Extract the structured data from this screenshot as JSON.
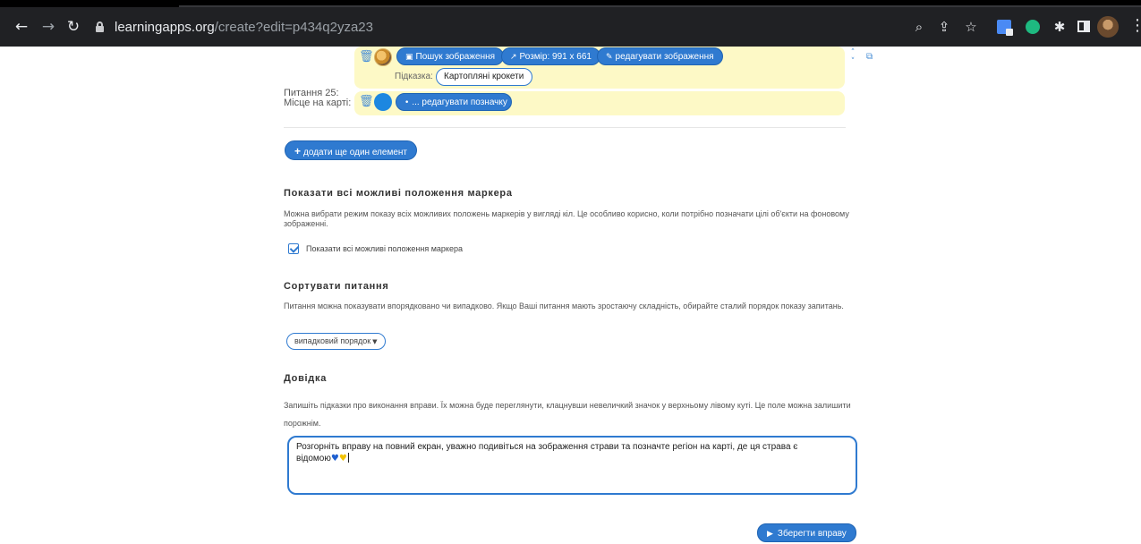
{
  "browser": {
    "url_host": "learningapps.org",
    "url_path": "/create?edit=p434q2yza23",
    "icons": [
      "back-arrow-icon",
      "forward-arrow-icon",
      "reload-icon",
      "lock-icon",
      "zoom-icon",
      "share-icon",
      "star-icon",
      "translate-extension-icon",
      "green-extension-icon",
      "puzzle-extension-icon",
      "side-panel-icon",
      "profile-avatar",
      "more-menu-icon"
    ]
  },
  "item": {
    "question_label": "Питання 25:",
    "search_image_label": "Пошук зображення",
    "size_label": "Розмір: 991 x 661",
    "edit_image_label": "редагувати зображення",
    "hint_label": "Підказка:",
    "hint_value": "Картопляні крокети",
    "map_place_label": "Місце на карті:",
    "edit_marker_label": "... редагувати позначку"
  },
  "add_element_label": "додати ще один елемент",
  "markers_section": {
    "heading": "Показати всі можливі положення маркера",
    "description": "Можна вибрати режим показу всіх можливих положень маркерів у вигляді кіл. Це особливо корисно, коли потрібно позначати цілі об'єкти на фоновому зображенні.",
    "checkbox_label": "Показати всі можливі положення маркера",
    "checked": true
  },
  "sort_section": {
    "heading": "Сортувати питання",
    "description": "Питання можна показувати впорядковано чи випадково. Якщо Ваші питання мають зростаючу складність, обирайте сталий порядок показу запитань.",
    "selected_option": "випадковий порядок"
  },
  "help_section": {
    "heading": "Довідка",
    "description": "Запишіть підказки про виконання вправи. Їх можна буде переглянути, клацнувши невеличкий значок у верхньому лівому куті. Це поле можна залишити порожнім.",
    "text": "Розгорніть вправу на повний екран, уважно подивіться на зображення страви та позначте регіон на карті, де ця страва є відомою"
  },
  "save_label": "Зберегти вправу",
  "colors": {
    "accent": "#2f7ad0",
    "row_bg": "#fdf9c6"
  }
}
